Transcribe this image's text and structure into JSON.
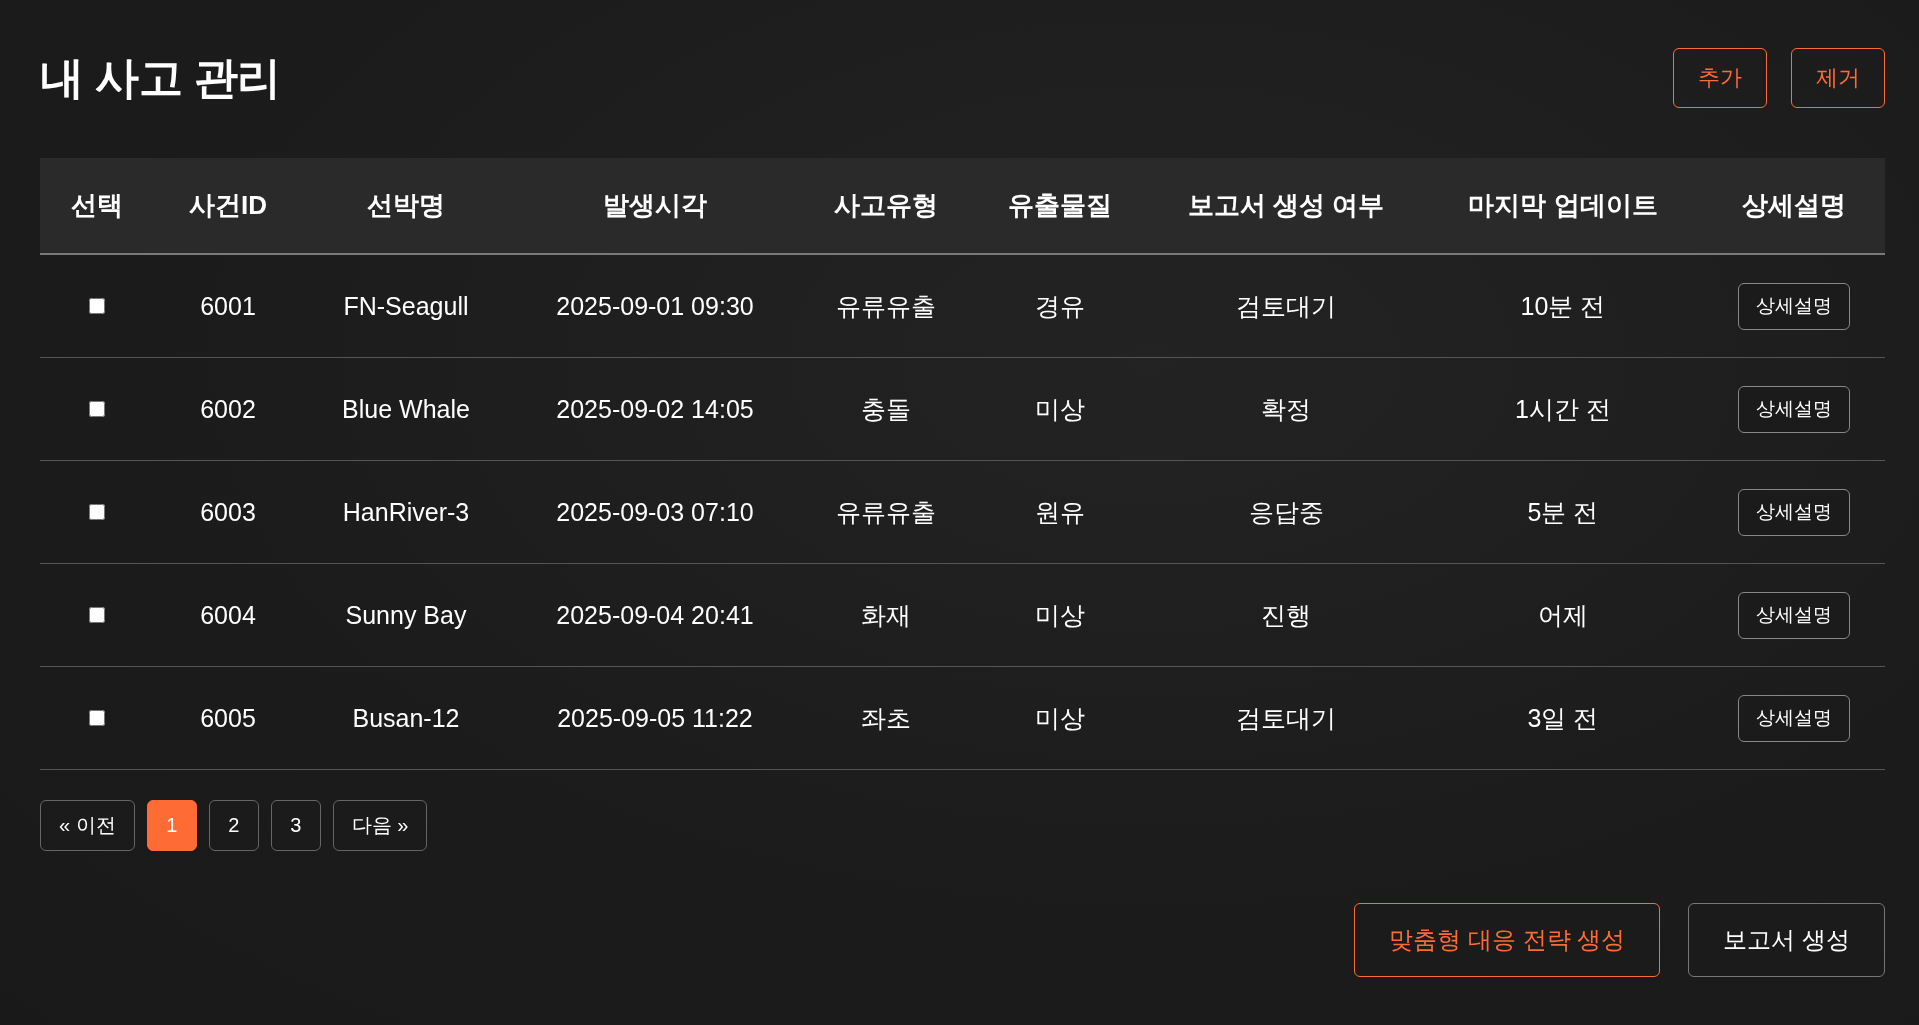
{
  "page": {
    "title": "내 사고 관리"
  },
  "toolbar": {
    "buttons": [
      {
        "label": "추가"
      },
      {
        "label": "제거"
      }
    ]
  },
  "table": {
    "columns": [
      "선택",
      "사건ID",
      "선박명",
      "발생시각",
      "사고유형",
      "유출물질",
      "보고서 생성 여부",
      "마지막 업데이트",
      "상세설명"
    ],
    "rows": [
      {
        "checked": false,
        "id": "6001",
        "vessel": "FN-Seagull",
        "occurred_at": "2025-09-01 09:30",
        "type": "유류유출",
        "substance": "경유",
        "report_status": "검토대기",
        "last_update": "10분 전",
        "detail_button": "상세설명"
      },
      {
        "checked": false,
        "id": "6002",
        "vessel": "Blue Whale",
        "occurred_at": "2025-09-02 14:05",
        "type": "충돌",
        "substance": "미상",
        "report_status": "확정",
        "last_update": "1시간 전",
        "detail_button": "상세설명"
      },
      {
        "checked": false,
        "id": "6003",
        "vessel": "HanRiver-3",
        "occurred_at": "2025-09-03 07:10",
        "type": "유류유출",
        "substance": "원유",
        "report_status": "응답중",
        "last_update": "5분 전",
        "detail_button": "상세설명"
      },
      {
        "checked": false,
        "id": "6004",
        "vessel": "Sunny Bay",
        "occurred_at": "2025-09-04 20:41",
        "type": "화재",
        "substance": "미상",
        "report_status": "진행",
        "last_update": "어제",
        "detail_button": "상세설명"
      },
      {
        "checked": false,
        "id": "6005",
        "vessel": "Busan-12",
        "occurred_at": "2025-09-05 11:22",
        "type": "좌초",
        "substance": "미상",
        "report_status": "검토대기",
        "last_update": "3일 전",
        "detail_button": "상세설명"
      }
    ]
  },
  "pagination": {
    "previous": "« 이전",
    "pages": [
      {
        "label": "1",
        "selected": true
      },
      {
        "label": "2",
        "selected": false
      },
      {
        "label": "3",
        "selected": false
      }
    ],
    "next": "다음 »"
  },
  "actions": [
    {
      "label": "맞춤형 대응 전략 생성",
      "kind": "primary"
    },
    {
      "label": "보고서 생성",
      "kind": "secondary"
    }
  ]
}
